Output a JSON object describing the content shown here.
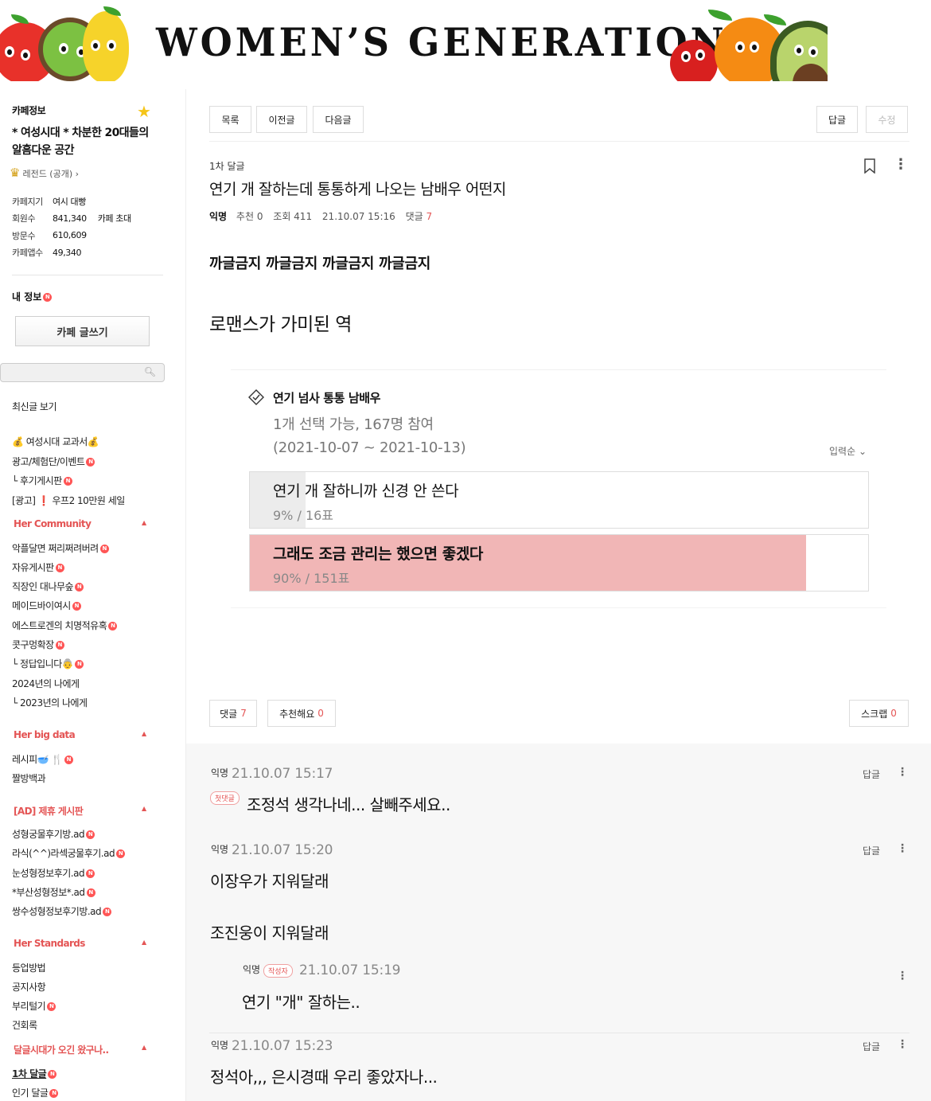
{
  "banner": {
    "title": "WOMEN’S GENERATION"
  },
  "sidebar": {
    "cafe_info_label": "카페정보",
    "cafe_name": "* 여성시대 * 차분한 20대들의 알흠다운 공간",
    "rank": "레전드 (공개)",
    "stats": [
      {
        "key": "카페지기",
        "value": "여시 대빵",
        "extra": ""
      },
      {
        "key": "회원수",
        "value": "841,340",
        "extra": "카페 초대"
      },
      {
        "key": "방문수",
        "value": "610,609",
        "extra": ""
      },
      {
        "key": "카페앱수",
        "value": "49,340",
        "extra": ""
      }
    ],
    "my_info": "내 정보",
    "write_button": "카페 글쓰기",
    "search_placeholder": "",
    "latest": "최신글 보기",
    "menu_top": [
      "💰 여성시대 교과서💰",
      "광고/체험단/이벤트",
      "└ 후기게시판",
      "[광고] ❗ 우프2 10만원 세일"
    ],
    "sections": [
      {
        "title": "Her Community",
        "items": [
          "악플달면 쩌리쩌려버려",
          "자유게시판",
          "직장인 대나무숲",
          "메이드바이여시",
          "에스트로겐의 치명적유혹",
          "콧구멍확장",
          "└ 정답입니다👵",
          "2024년의 나에게",
          "└ 2023년의 나에게"
        ]
      },
      {
        "title": "Her big data",
        "items": [
          "레시피🥣 🍴",
          "짤방백과"
        ]
      },
      {
        "title": "[AD] 제휴 게시판",
        "items": [
          "성형궁물후기방.ad",
          "라식(^^)라섹궁물후기.ad",
          "눈성형정보후기.ad",
          "*부산성형정보*.ad",
          "쌍수성형정보후기방.ad"
        ]
      },
      {
        "title": "Her Standards",
        "items": [
          "등업방법",
          "공지사항",
          "부리털기",
          "건회록"
        ]
      },
      {
        "title": "달글시대가 오긴 왔구나..",
        "items": [
          "1차 달글",
          "인기 달글"
        ]
      }
    ]
  },
  "toolbar": {
    "list": "목록",
    "prev": "이전글",
    "next": "다음글",
    "reply": "답글",
    "edit": "수정"
  },
  "post": {
    "board": "1차 달글",
    "title": "연기 개 잘하는데 통통하게 나오는 남배우 어떤지",
    "author": "익명",
    "recommend": "추천 0",
    "views": "조회 411",
    "date": "21.10.07 15:16",
    "comments_label": "댓글",
    "comments_count": "7",
    "body_line1": "까글금지 까글금지 까글금지 까글금지",
    "body_line2": "로맨스가 가미된 역"
  },
  "poll": {
    "title": "연기 넘사 통통 남배우",
    "info_line1": "1개 선택 가능, 167명 참여",
    "info_line2": "(2021-10-07 ~ 2021-10-13)",
    "sort": "입력순",
    "options": [
      {
        "text": "연기 개 잘하니까 신경 안 쓴다",
        "count": "9% / 16표",
        "percent": 9,
        "color": "#ececec"
      },
      {
        "text": "그래도 조금 관리는 했으면 좋겠다",
        "count": "90% / 151표",
        "percent": 90,
        "color": "#f1b6b6"
      }
    ]
  },
  "footer": {
    "comments_label": "댓글",
    "comments_count": "7",
    "like_label": "추천해요",
    "like_count": "0",
    "scrap_label": "스크랩",
    "scrap_count": "0"
  },
  "comments": [
    {
      "author": "익명",
      "date": "21.10.07 15:17",
      "tag": "첫댓글",
      "text": "조정석 생각나네... 살빼주세요..",
      "reply": "답글"
    },
    {
      "author": "익명",
      "date": "21.10.07 15:20",
      "text": "이장우가 지워달래",
      "text2": "조진웅이 지워달래",
      "reply": "답글"
    },
    {
      "author": "익명",
      "date": "21.10.07 15:19",
      "tag": "작성자",
      "text": "연기 \"개\" 잘하는.."
    },
    {
      "author": "익명",
      "date": "21.10.07 15:23",
      "text": "정석아,,, 은시경때 우리 좋았자나...",
      "reply": "답글"
    }
  ]
}
